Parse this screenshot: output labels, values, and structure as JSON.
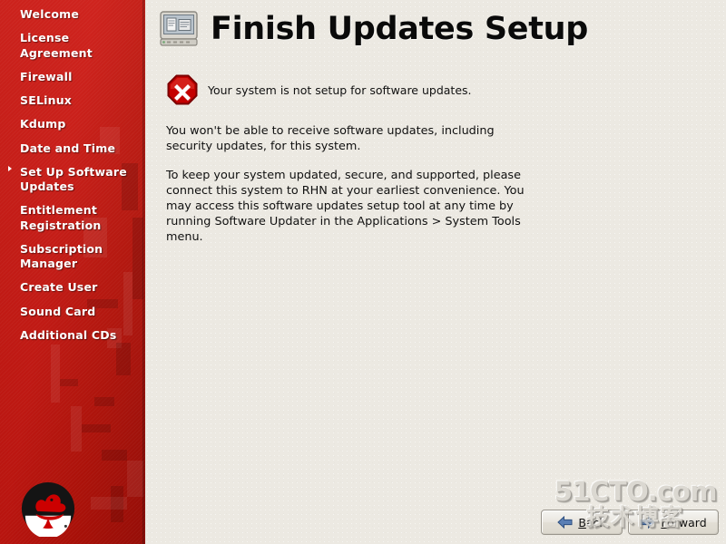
{
  "sidebar": {
    "items": [
      {
        "label": "Welcome",
        "selected": false
      },
      {
        "label": "License Agreement",
        "selected": false
      },
      {
        "label": "Firewall",
        "selected": false
      },
      {
        "label": "SELinux",
        "selected": false
      },
      {
        "label": "Kdump",
        "selected": false
      },
      {
        "label": "Date and Time",
        "selected": false
      },
      {
        "label": "Set Up Software Updates",
        "selected": true
      },
      {
        "label": "Entitlement Registration",
        "selected": false
      },
      {
        "label": "Subscription Manager",
        "selected": false
      },
      {
        "label": "Create User",
        "selected": false
      },
      {
        "label": "Sound Card",
        "selected": false
      },
      {
        "label": "Additional CDs",
        "selected": false
      }
    ],
    "logo_name": "red-hat-shadowman-logo",
    "background_color": "#c8140e"
  },
  "header": {
    "title": "Finish Updates Setup",
    "icon_name": "monitor-icon"
  },
  "status": {
    "icon_name": "error-octagon-icon",
    "icon_color": "#c00000",
    "message": "Your system is not setup for software updates."
  },
  "body": {
    "paragraphs": [
      "You won't be able to receive software updates, including security updates, for this system.",
      "To keep your system updated, secure, and supported, please connect this system to RHN at your earliest convenience. You may access this software updates setup tool at any time by running Software Updater in the Applications > System Tools menu."
    ]
  },
  "buttons": {
    "back": {
      "label_prefix": "",
      "label_mnemonic": "B",
      "label_suffix": "ack",
      "icon_name": "arrow-left-icon"
    },
    "forward": {
      "label_prefix": "",
      "label_mnemonic": "F",
      "label_suffix": "orward",
      "icon_name": "arrow-right-icon"
    }
  },
  "watermark": {
    "line1": "51CTO.com",
    "line2": "技术博客"
  }
}
